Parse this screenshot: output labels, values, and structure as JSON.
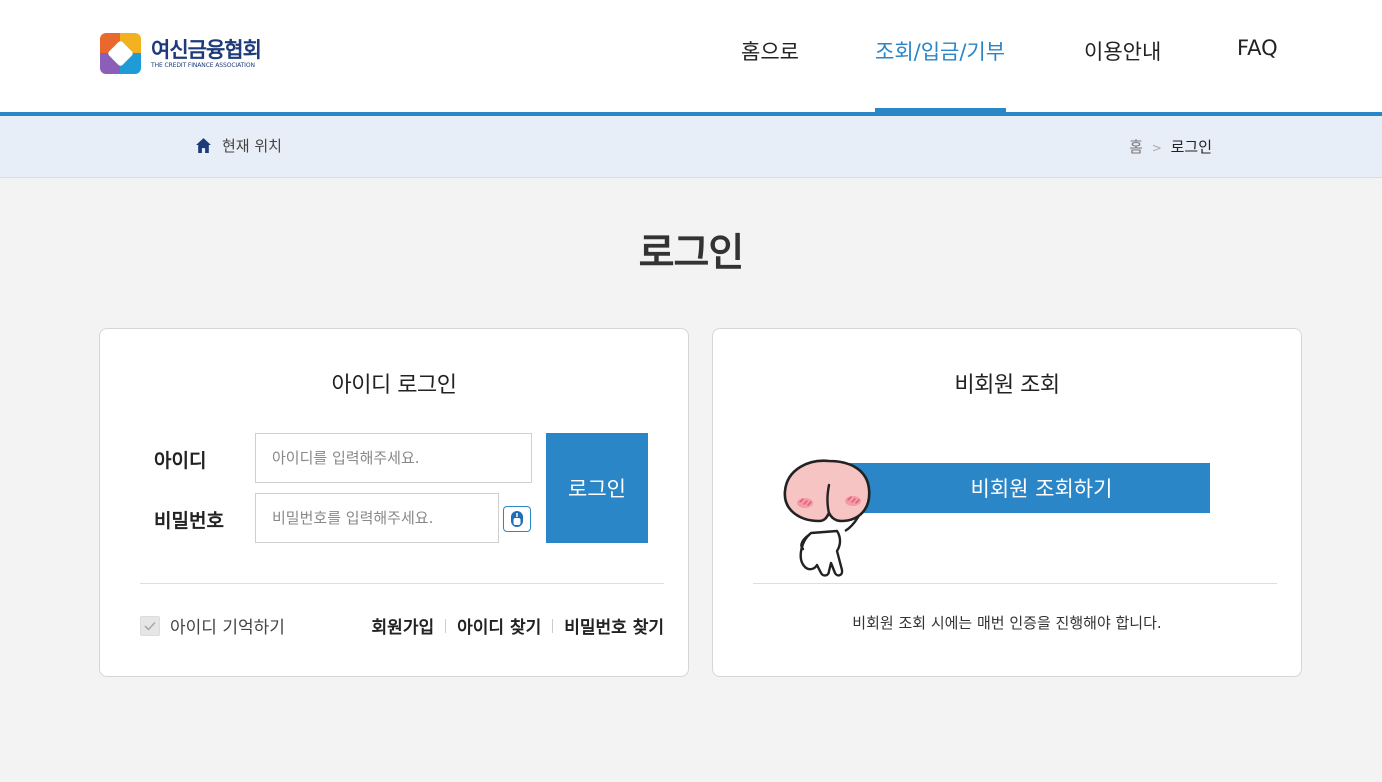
{
  "header": {
    "logo_kr": "여신금융협회",
    "logo_en": "THE CREDIT FINANCE ASSOCIATION",
    "nav": [
      "홈으로",
      "조회/입금/기부",
      "이용안내",
      "FAQ"
    ],
    "active_nav": "조회/입금/기부",
    "accent_color": "#2b86c8"
  },
  "location": {
    "label": "현재 위치",
    "crumb_home": "홈",
    "crumb_sep": ">",
    "crumb_current": "로그인"
  },
  "page": {
    "title": "로그인"
  },
  "member_login": {
    "title": "아이디 로그인",
    "id_label": "아이디",
    "id_placeholder": "아이디를 입력해주세요.",
    "pw_label": "비밀번호",
    "pw_placeholder": "비밀번호를 입력해주세요.",
    "login_button": "로그인",
    "remember_label": "아이디 기억하기",
    "remember_checked": true,
    "links": [
      "회원가입",
      "아이디 찾기",
      "비밀번호 찾기"
    ]
  },
  "guest": {
    "title": "비회원 조회",
    "button": "비회원 조회하기",
    "note": "비회원 조회 시에는 매번 인증을 진행해야 합니다."
  }
}
